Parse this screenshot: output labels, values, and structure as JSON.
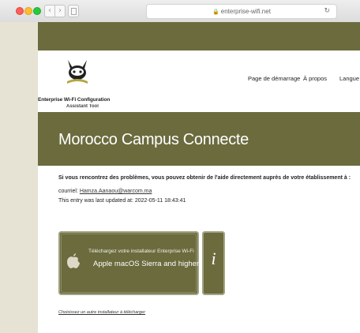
{
  "browser": {
    "url": "enterprise-wifi.net",
    "back_glyph": "‹",
    "forward_glyph": "›",
    "lock_glyph": "🔒",
    "reload_glyph": "↻"
  },
  "header": {
    "site_title": "Enterprise Wi-Fi Configuration",
    "site_subtitle": "Assistant Tool",
    "nav": [
      "Page de démarrage",
      "À propos",
      "Langue"
    ]
  },
  "banner": {
    "title": "Morocco Campus Connecte"
  },
  "content": {
    "notice": "Si vous rencontrez des problèmes, vous pouvez obtenir de l'aide directement auprès de votre établissement à :",
    "contact_label": "courriel:",
    "contact_email": "Hamza.Aanaou@warcom.ma",
    "updated_text": "This entry was last updated at: 2022-05-11 18:43:41"
  },
  "installer": {
    "line1": "Téléchargez votre installateur Enterprise Wi-Fi",
    "line2": "Apple macOS Sierra and higher",
    "icon": "apple-icon"
  },
  "info_button": {
    "glyph": "i",
    "icon": "info-icon"
  },
  "other_installer_link": "Choisissez un autre installateur à télécharger",
  "colors": {
    "olive": "#6b6b3e",
    "gutter": "#e6e3d5",
    "white": "#ffffff"
  }
}
